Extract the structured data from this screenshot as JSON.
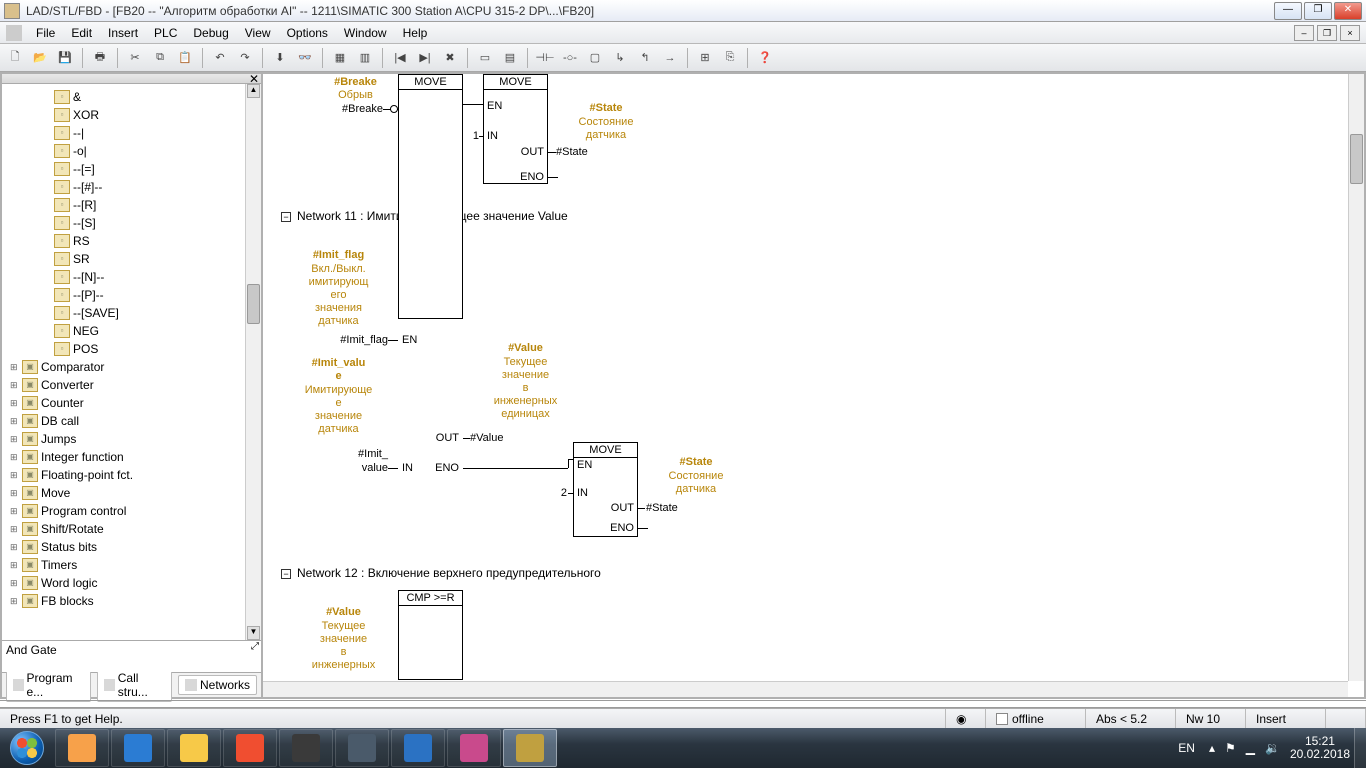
{
  "title": "LAD/STL/FBD  - [FB20 -- \"Алгоритм обработки AI\" -- 1211\\SIMATIC 300 Station A\\CPU 315-2 DP\\...\\FB20]",
  "menus": [
    "File",
    "Edit",
    "Insert",
    "PLC",
    "Debug",
    "View",
    "Options",
    "Window",
    "Help"
  ],
  "tree_leaf": [
    "&",
    "XOR",
    "--|",
    "-o|",
    "--[=]",
    "--[#]--",
    "--[R]",
    "--[S]",
    "RS",
    "SR",
    "--[N]--",
    "--[P]--",
    "--[SAVE]",
    "NEG",
    "POS"
  ],
  "tree_grp": [
    "Comparator",
    "Converter",
    "Counter",
    "DB call",
    "Jumps",
    "Integer function",
    "Floating-point fct.",
    "Move",
    "Program control",
    "Shift/Rotate",
    "Status bits",
    "Timers",
    "Word logic",
    "FB blocks"
  ],
  "desc": "And Gate",
  "tabs": [
    "Program e...",
    "Call stru...",
    "Networks"
  ],
  "net11": {
    "title": "Network 11 : Имитируем текущее значение Value"
  },
  "net12": {
    "title": "Network 12 : Включение верхнего предупредительного"
  },
  "labels": {
    "breake": "#Breake",
    "breake_c": "Обрыв",
    "breake_p": "#Breake",
    "move": "MOVE",
    "en": "EN",
    "in": "IN",
    "out": "OUT",
    "eno": "ENO",
    "one": "1",
    "two": "2",
    "state": "#State",
    "state_c1": "Состояние",
    "state_c2": "датчика",
    "state_p": "#State",
    "imfl": "#Imit_flag",
    "imfl_c1": "Вкл./Выкл.",
    "imfl_c2": "имитирующ",
    "imfl_c3": "его",
    "imfl_c4": "значения",
    "imfl_c5": "датчика",
    "imfl_p": "#Imit_flag",
    "imvl": "#Imit_valu",
    "imvl2": "e",
    "imvl_c1": "Имитирующе",
    "imvl_c2": "е",
    "imvl_c3": "значение",
    "imvl_c4": "датчика",
    "imvl_p1": "#Imit_",
    "imvl_p2": "value",
    "value": "#Value",
    "value_c1": "Текущее",
    "value_c2": "значение",
    "value_c3": "в",
    "value_c4": "инженерных",
    "value_c5": "единицах",
    "value_p": "#Value",
    "cmp": "CMP >=R"
  },
  "status": {
    "help": "Press F1 to get Help.",
    "offline": "offline",
    "abs": "Abs < 5.2",
    "nw": "Nw 10",
    "ins": "Insert"
  },
  "tray": {
    "lang": "EN",
    "time": "15:21",
    "date": "20.02.2018"
  },
  "task_colors": [
    "#f7a14a",
    "#2b7cd3",
    "#f7c948",
    "#f04e30",
    "#3a3a3a",
    "#4a5a6a",
    "#2b72c3",
    "#c94a8c",
    "#c0a040"
  ]
}
